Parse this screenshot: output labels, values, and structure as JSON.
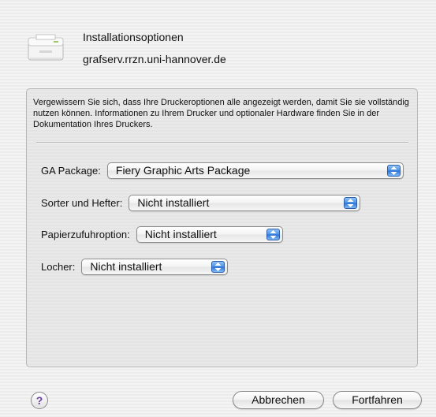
{
  "header": {
    "title": "Installationsoptionen",
    "host": "grafserv.rrzn.uni-hannover.de"
  },
  "panel": {
    "description": "Vergewissern Sie sich, dass Ihre Druckeroptionen alle angezeigt werden, damit Sie sie vollständig nutzen können. Informationen zu Ihrem Drucker und optionaler Hardware finden Sie in der Dokumentation Ihres Druckers.",
    "options": [
      {
        "label": "GA Package:",
        "value": "Fiery Graphic Arts Package"
      },
      {
        "label": "Sorter und Hefter:",
        "value": "Nicht installiert"
      },
      {
        "label": "Papierzufuhroption:",
        "value": "Nicht installiert"
      },
      {
        "label": "Locher:",
        "value": "Nicht installiert"
      }
    ]
  },
  "footer": {
    "help_label": "?",
    "cancel_label": "Abbrechen",
    "continue_label": "Fortfahren"
  },
  "icons": {
    "printer": "printer-icon",
    "popup_arrows": "popup-arrows-icon",
    "help": "help-icon"
  },
  "colors": {
    "accent": "#3b82e0",
    "help_glyph": "#6b3fa0"
  }
}
